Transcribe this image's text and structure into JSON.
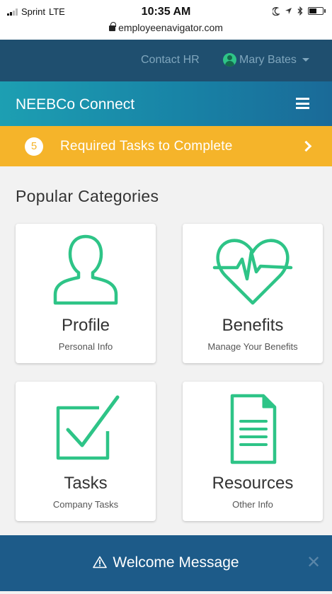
{
  "status_bar": {
    "carrier": "Sprint",
    "network": "LTE",
    "time": "10:35 AM",
    "url": "employeenavigator.com"
  },
  "top_nav": {
    "contact_hr": "Contact HR",
    "user_name": "Mary Bates"
  },
  "header": {
    "title": "NEEBCo Connect"
  },
  "tasks_banner": {
    "count": "5",
    "text": "Required Tasks to Complete"
  },
  "main": {
    "section_title": "Popular Categories",
    "cards": [
      {
        "title": "Profile",
        "subtitle": "Personal Info",
        "icon": "person-icon"
      },
      {
        "title": "Benefits",
        "subtitle": "Manage Your Benefits",
        "icon": "heart-pulse-icon"
      },
      {
        "title": "Tasks",
        "subtitle": "Company Tasks",
        "icon": "checkbox-icon"
      },
      {
        "title": "Resources",
        "subtitle": "Other Info",
        "icon": "document-icon"
      }
    ]
  },
  "welcome": {
    "text": "Welcome Message"
  },
  "colors": {
    "accent_green": "#2ec487",
    "nav_dark": "#1f4f6f",
    "banner_yellow": "#f5b42a",
    "footer_blue": "#1d5b89"
  }
}
